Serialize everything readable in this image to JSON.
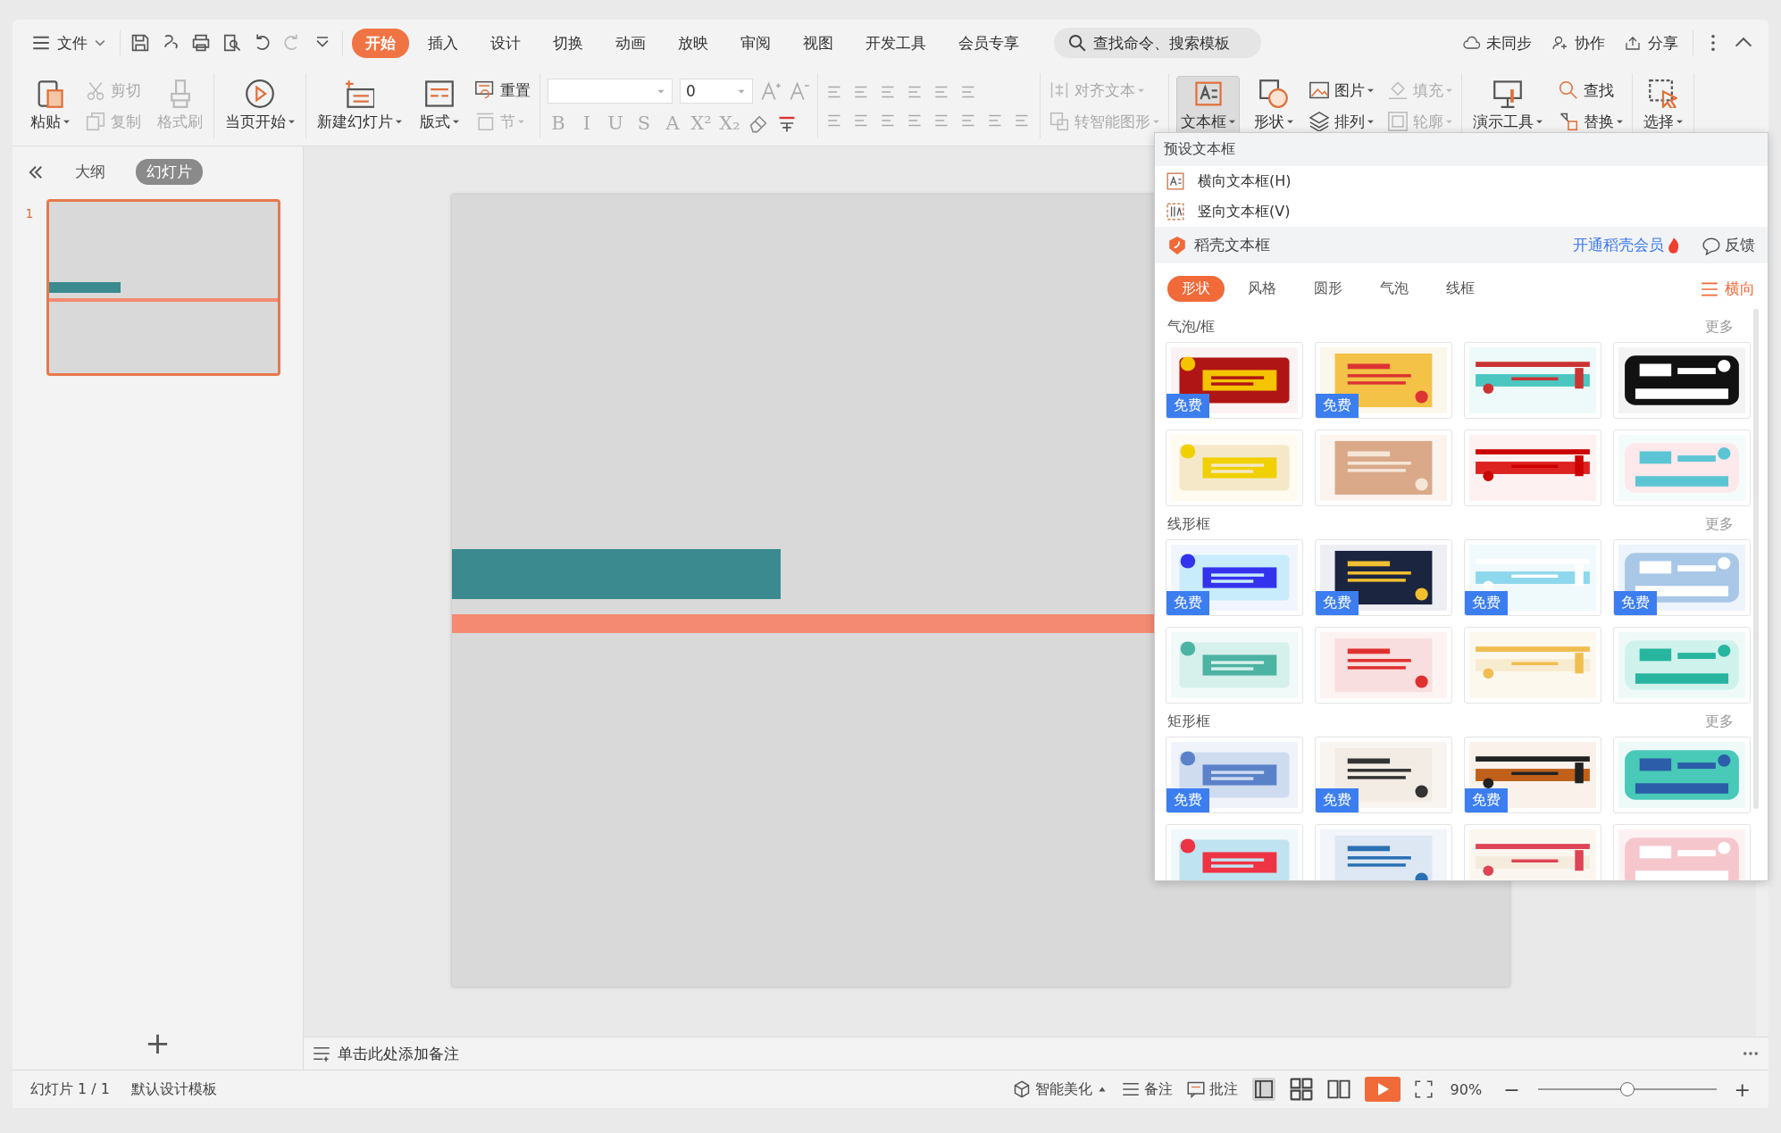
{
  "menu_bar": {
    "file_menu": "文件",
    "tabs": [
      {
        "label": "开始",
        "selected": true
      },
      {
        "label": "插入",
        "selected": false
      },
      {
        "label": "设计",
        "selected": false
      },
      {
        "label": "切换",
        "selected": false
      },
      {
        "label": "动画",
        "selected": false
      },
      {
        "label": "放映",
        "selected": false
      },
      {
        "label": "审阅",
        "selected": false
      },
      {
        "label": "视图",
        "selected": false
      },
      {
        "label": "开发工具",
        "selected": false
      },
      {
        "label": "会员专享",
        "selected": false
      }
    ],
    "search": {
      "placeholder": "查找命令、搜索模板"
    },
    "actions": [
      "未同步",
      "协作",
      "分享"
    ]
  },
  "ribbon": {
    "groups": [
      {
        "columns": [
          [
            {
              "label": "粘贴",
              "disabled": false,
              "dropdown": true,
              "pressed": false
            }
          ],
          [
            {
              "label": "剪切",
              "disabled": true,
              "dropdown": false,
              "pressed": false
            },
            {
              "label": "复制",
              "disabled": true,
              "dropdown": false,
              "pressed": false
            }
          ],
          [
            {
              "label": "格式刷",
              "disabled": true,
              "dropdown": false,
              "pressed": false
            }
          ]
        ]
      },
      {
        "columns": [
          [
            {
              "label": "当页开始",
              "disabled": false,
              "dropdown": true,
              "pressed": false
            }
          ]
        ]
      },
      {
        "columns": [
          [
            {
              "label": "新建幻灯片",
              "disabled": false,
              "dropdown": true,
              "pressed": false
            }
          ],
          [
            {
              "label": "版式",
              "disabled": false,
              "dropdown": true,
              "pressed": false
            }
          ],
          [
            {
              "label": "重置",
              "disabled": false,
              "dropdown": false,
              "pressed": false
            },
            {
              "label": "节",
              "disabled": true,
              "dropdown": true,
              "pressed": false
            }
          ]
        ]
      },
      {
        "font": {
          "size": "0"
        },
        "format_buttons": [
          {
            "label": "B",
            "disabled": true
          },
          {
            "label": "I",
            "disabled": true
          },
          {
            "label": "U",
            "disabled": true
          },
          {
            "label": "S",
            "disabled": true
          },
          {
            "label": "A",
            "disabled": true
          },
          {
            "label": "X²",
            "disabled": true
          },
          {
            "label": "X₂",
            "disabled": true
          }
        ]
      },
      {
        "columns": [
          [
            {
              "label": "对齐文本",
              "disabled": true,
              "dropdown": true,
              "pressed": false
            },
            {
              "label": "转智能图形",
              "disabled": true,
              "dropdown": true,
              "pressed": false
            }
          ]
        ]
      },
      {
        "columns": [
          [
            {
              "label": "文本框",
              "disabled": false,
              "dropdown": true,
              "pressed": true
            }
          ],
          [
            {
              "label": "形状",
              "disabled": false,
              "dropdown": true,
              "pressed": false
            }
          ],
          [
            {
              "label": "图片",
              "disabled": false,
              "dropdown": true,
              "pressed": false
            },
            {
              "label": "排列",
              "disabled": false,
              "dropdown": true,
              "pressed": false
            }
          ],
          [
            {
              "label": "填充",
              "disabled": true,
              "dropdown": true,
              "pressed": false
            },
            {
              "label": "轮廓",
              "disabled": true,
              "dropdown": true,
              "pressed": false
            }
          ]
        ]
      },
      {
        "columns": [
          [
            {
              "label": "演示工具",
              "disabled": false,
              "dropdown": true,
              "pressed": false
            }
          ],
          [
            {
              "label": "查找",
              "disabled": false,
              "dropdown": false,
              "pressed": false
            },
            {
              "label": "替换",
              "disabled": false,
              "dropdown": true,
              "pressed": false
            }
          ]
        ]
      },
      {
        "columns": [
          [
            {
              "label": "选择",
              "disabled": false,
              "dropdown": true,
              "pressed": false
            }
          ]
        ]
      }
    ]
  },
  "side_panel": {
    "tabs": [
      {
        "label": "大纲",
        "selected": false
      },
      {
        "label": "幻灯片",
        "selected": true
      }
    ],
    "slides": [
      {
        "number": "1",
        "selected": true
      }
    ],
    "add_button": "+"
  },
  "notes": {
    "placeholder": "单击此处添加备注"
  },
  "textbox_menu": {
    "title": "预设文本框",
    "items": [
      "横向文本框(H)",
      "竖向文本框(V)"
    ],
    "docer": {
      "title": "稻壳文本框",
      "member_link": "开通稻壳会员",
      "feedback": "反馈"
    },
    "tabs": [
      {
        "label": "形状",
        "selected": true
      },
      {
        "label": "风格",
        "selected": false
      },
      {
        "label": "圆形",
        "selected": false
      },
      {
        "label": "气泡",
        "selected": false
      },
      {
        "label": "线框",
        "selected": false
      }
    ],
    "orientation": "横向",
    "sections": [
      {
        "title": "气泡/框",
        "more": "更多",
        "templates": [
          {
            "kind": "picture",
            "badge": "免费"
          },
          {
            "kind": "picture",
            "badge": "免费"
          },
          {
            "kind": "picture"
          },
          {
            "kind": "picture"
          },
          {
            "kind": "picture"
          },
          {
            "kind": "picture"
          },
          {
            "kind": "picture"
          },
          {
            "kind": "picture"
          }
        ]
      },
      {
        "title": "线形框",
        "more": "更多",
        "templates": [
          {
            "kind": "picture",
            "badge": "免费"
          },
          {
            "kind": "picture",
            "badge": "免费"
          },
          {
            "kind": "picture",
            "badge": "免费"
          },
          {
            "kind": "picture",
            "badge": "免费"
          },
          {
            "kind": "picture"
          },
          {
            "kind": "picture"
          },
          {
            "kind": "picture"
          },
          {
            "kind": "picture"
          }
        ]
      },
      {
        "title": "矩形框",
        "more": "更多",
        "templates": [
          {
            "kind": "picture",
            "badge": "免费"
          },
          {
            "kind": "picture",
            "badge": "免费"
          },
          {
            "kind": "picture",
            "badge": "免费"
          },
          {
            "kind": "picture"
          },
          {
            "kind": "picture"
          },
          {
            "kind": "picture"
          },
          {
            "kind": "picture"
          },
          {
            "kind": "picture"
          }
        ]
      }
    ]
  },
  "status_bar": {
    "slide_info": "幻灯片 1 / 1",
    "template": "默认设计模板",
    "beautify": "智能美化",
    "notes": "备注",
    "comments": "批注",
    "zoom": "90%",
    "zoom_slider": {
      "level": 0.5
    },
    "zoom_out": "−",
    "zoom_in": "+"
  }
}
